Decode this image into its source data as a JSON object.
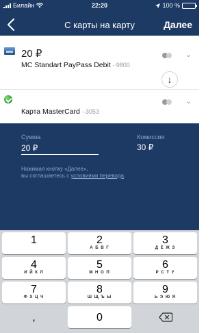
{
  "status_bar": {
    "carrier": "Билайн",
    "time": "22:20",
    "battery": "100 %"
  },
  "nav": {
    "title": "С карты на карту",
    "next_label": "Далее"
  },
  "from_card": {
    "amount": "20 ₽",
    "name": "MC Standart PayPass Debit",
    "mask": "··9800"
  },
  "to_card": {
    "name": "Карта MasterCard",
    "mask": "··3053"
  },
  "form": {
    "sum_label": "Сумма",
    "sum_value": "20 ₽",
    "fee_label": "Комиссия",
    "fee_value": "30 ₽",
    "note_prefix": "Нажимая кнопку «Далее»,",
    "note_middle": "вы соглашаетесь с ",
    "note_link": "условиями перевода",
    "note_suffix": "."
  },
  "keyboard": {
    "keys": [
      {
        "digit": "1",
        "letters": ""
      },
      {
        "digit": "2",
        "letters": "А Б В Г"
      },
      {
        "digit": "3",
        "letters": "Д Е Ж З"
      },
      {
        "digit": "4",
        "letters": "И Й К Л"
      },
      {
        "digit": "5",
        "letters": "М Н О П"
      },
      {
        "digit": "6",
        "letters": "Р С Т У"
      },
      {
        "digit": "7",
        "letters": "Ф Х Ц Ч"
      },
      {
        "digit": "8",
        "letters": "Ш Щ Ъ Ы"
      },
      {
        "digit": "9",
        "letters": "Ь Э Ю Я"
      }
    ],
    "comma": ",",
    "zero": "0"
  },
  "icons": {
    "back": "chevron-left-icon",
    "swap": "arrow-down-icon",
    "delete": "backspace-icon",
    "wifi": "wifi-icon",
    "location": "location-arrow-icon"
  },
  "colors": {
    "brand": "#1d3a64",
    "keyboard_bg": "#d1d4d9",
    "muted": "#8aa3c7"
  }
}
